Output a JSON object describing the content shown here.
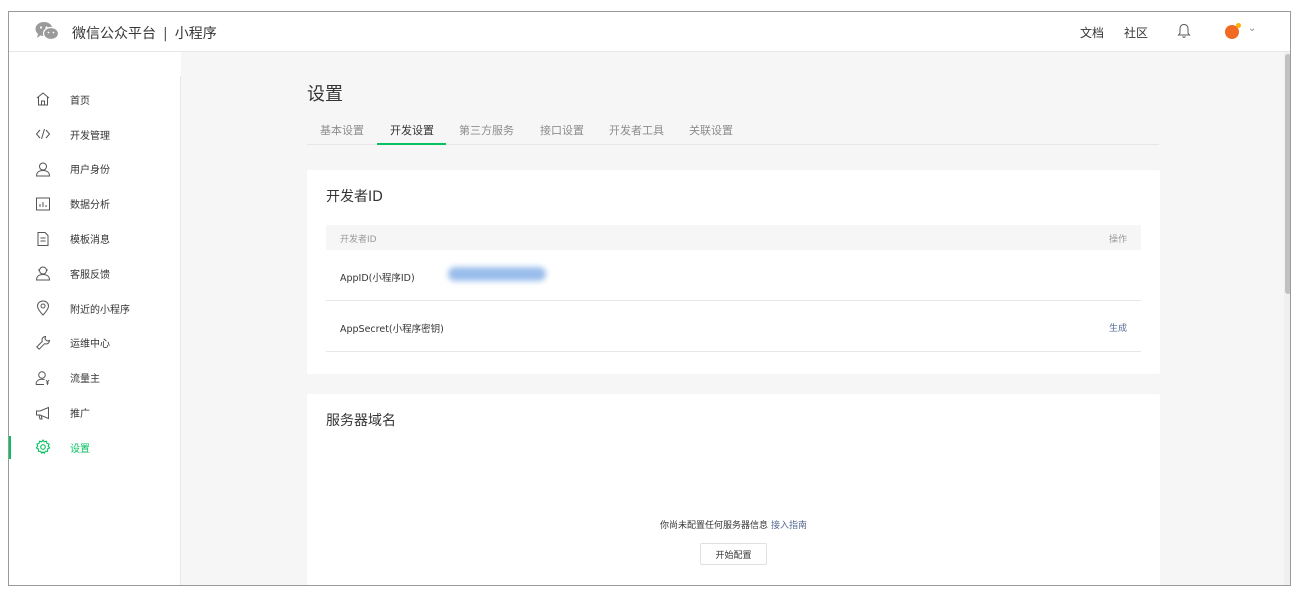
{
  "header": {
    "brand": "微信公众平台",
    "separator": "|",
    "product": "小程序",
    "links": [
      "文档",
      "社区"
    ],
    "avatar_color": "#f06a22"
  },
  "sidebar": {
    "active_color": "#07c160",
    "items": [
      {
        "label": "首页",
        "icon": "home-icon"
      },
      {
        "label": "开发管理",
        "icon": "code-icon"
      },
      {
        "label": "用户身份",
        "icon": "user-icon"
      },
      {
        "label": "数据分析",
        "icon": "chart-icon"
      },
      {
        "label": "模板消息",
        "icon": "document-icon"
      },
      {
        "label": "客服反馈",
        "icon": "customer-service-icon"
      },
      {
        "label": "附近的小程序",
        "icon": "location-icon"
      },
      {
        "label": "运维中心",
        "icon": "wrench-icon"
      },
      {
        "label": "流量主",
        "icon": "traffic-user-icon"
      },
      {
        "label": "推广",
        "icon": "megaphone-icon"
      },
      {
        "label": "设置",
        "icon": "gear-icon",
        "active": true
      }
    ]
  },
  "main": {
    "title": "设置",
    "tabs": [
      "基本设置",
      "开发设置",
      "第三方服务",
      "接口设置",
      "开发者工具",
      "关联设置"
    ],
    "active_tab": 1
  },
  "developer_id": {
    "title": "开发者ID",
    "columns": [
      "开发者ID",
      "操作"
    ],
    "rows": [
      {
        "name": "AppID(小程序ID)",
        "value_redacted": true,
        "action": ""
      },
      {
        "name": "AppSecret(小程序密钥)",
        "action": "生成"
      }
    ]
  },
  "server_domain": {
    "title": "服务器域名",
    "empty_text": "你尚未配置任何服务器信息",
    "guide_link": "接入指南",
    "start_button": "开始配置"
  }
}
